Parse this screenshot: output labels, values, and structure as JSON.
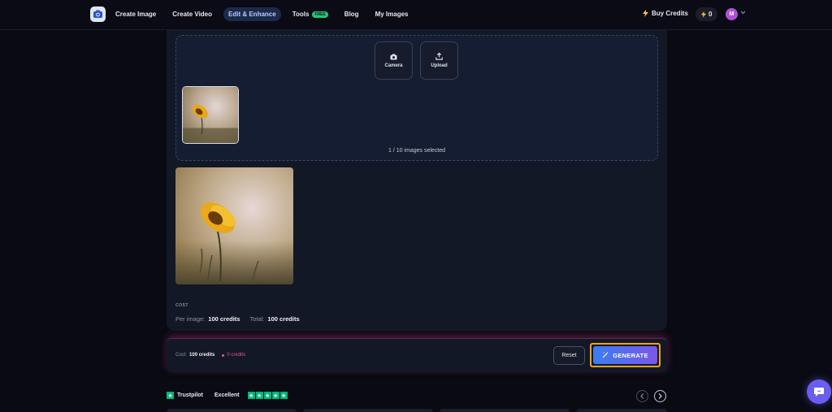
{
  "nav": {
    "items": [
      {
        "label": "Create Image",
        "active": false
      },
      {
        "label": "Create Video",
        "active": false
      },
      {
        "label": "Edit & Enhance",
        "active": true
      },
      {
        "label": "Tools",
        "active": false,
        "badge": "FREE"
      },
      {
        "label": "Blog",
        "active": false
      },
      {
        "label": "My Images",
        "active": false
      }
    ],
    "buy_credits": "Buy Credits",
    "credit_balance": "0",
    "avatar_initial": "M"
  },
  "upload": {
    "camera_label": "Camera",
    "upload_label": "Upload",
    "selected_count": "1 / 10 images selected"
  },
  "cost": {
    "section_label": "COST",
    "per_image_label": "Per image:",
    "per_image_value": "100 credits",
    "total_label": "Total:",
    "total_value": "100 credits"
  },
  "action_bar": {
    "cost_label": "Cost:",
    "cost_value": "100 credits",
    "balance_value": "0 credits",
    "reset_label": "Reset",
    "generate_label": "GENERATE"
  },
  "trustpilot": {
    "brand": "Trustpilot",
    "rating_text": "Excellent",
    "stars": 5
  },
  "colors": {
    "accent_blue": "#3a7df2",
    "accent_purple": "#7a58e8",
    "highlight_orange": "#f2a21b",
    "trustpilot_green": "#00b67a",
    "credit_pink": "#e65590"
  }
}
